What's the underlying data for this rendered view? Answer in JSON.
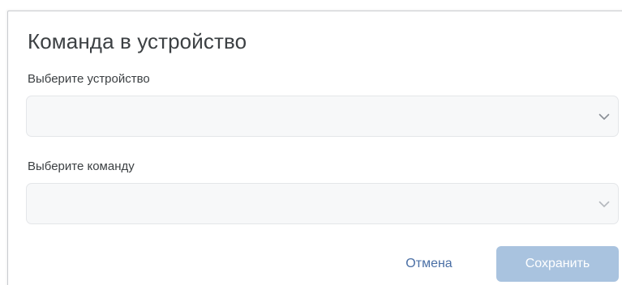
{
  "dialog": {
    "title": "Команда в устройство"
  },
  "device_field": {
    "label": "Выберите устройство",
    "value": "",
    "icon": "chevron-down-icon"
  },
  "command_field": {
    "label": "Выберите команду",
    "value": "",
    "icon": "chevron-down-icon",
    "disabled": true
  },
  "actions": {
    "cancel_label": "Отмена",
    "save_label": "Сохранить",
    "save_disabled": true
  },
  "colors": {
    "text": "#3c4043",
    "link": "#4a6fa5",
    "primary_disabled": "#a9c3df",
    "field_bg": "#f7f8f9",
    "field_border": "#e4e6e9"
  }
}
